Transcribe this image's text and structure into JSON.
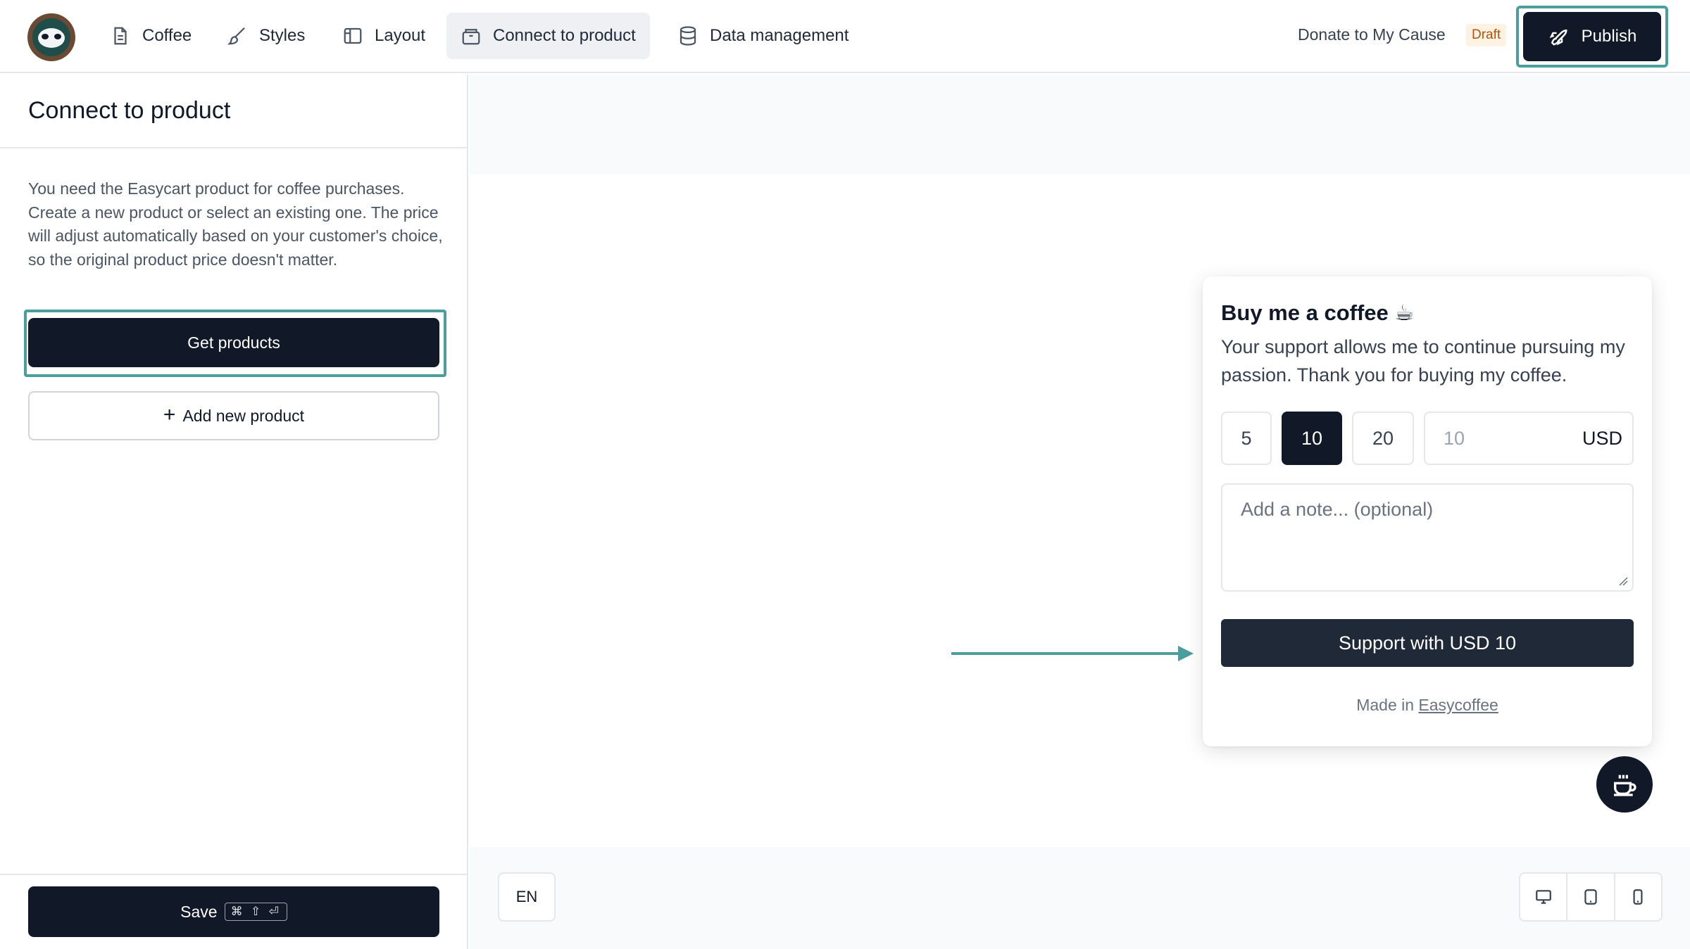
{
  "topbar": {
    "nav": [
      {
        "label": "Coffee",
        "icon": "document-icon"
      },
      {
        "label": "Styles",
        "icon": "brush-icon"
      },
      {
        "label": "Layout",
        "icon": "layout-icon"
      },
      {
        "label": "Connect to product",
        "icon": "box-icon",
        "active": true
      },
      {
        "label": "Data management",
        "icon": "database-icon"
      }
    ],
    "project_name": "Donate to My Cause",
    "status_badge": "Draft",
    "publish_label": "Publish"
  },
  "sidebar": {
    "title": "Connect to product",
    "description": "You need the Easycart product for coffee purchases. Create a new product or select an existing one. The price will adjust automatically based on your customer's choice, so the original product price doesn't matter.",
    "get_products_label": "Get products",
    "add_product_label": "Add new product",
    "save_label": "Save",
    "save_shortcut": "⌘ ⇧ ⏎"
  },
  "widget": {
    "title": "Buy me a coffee ☕",
    "description": "Your support allows me to continue pursuing my passion. Thank you for buying my coffee.",
    "amounts": [
      "5",
      "10",
      "20"
    ],
    "selected_amount": "10",
    "custom_amount_value": "10",
    "currency": "USD",
    "note_placeholder": "Add a note... (optional)",
    "support_label": "Support with USD 10",
    "made_in_prefix": "Made in",
    "made_in_link": "Easycoffee"
  },
  "canvas": {
    "language": "EN",
    "devices": [
      "desktop-icon",
      "tablet-icon",
      "mobile-icon"
    ]
  },
  "colors": {
    "primary": "#111827",
    "highlight": "#4a9e9e",
    "draft_badge_bg": "#fef3e2",
    "draft_badge_text": "#b45309"
  }
}
